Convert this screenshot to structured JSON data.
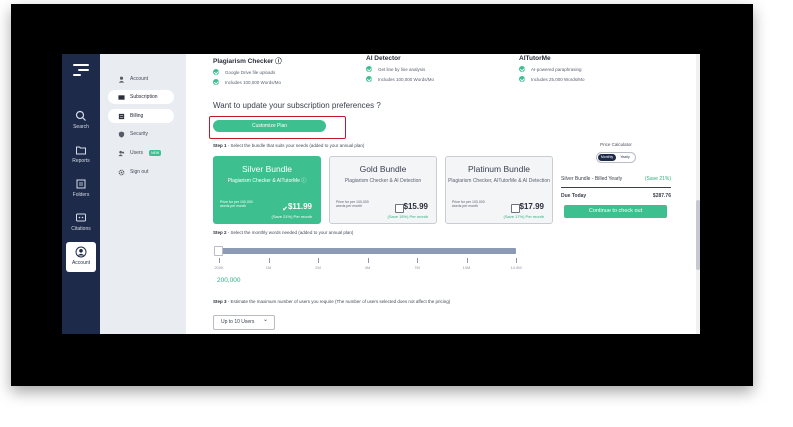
{
  "rail": {
    "items": [
      {
        "label": "Search"
      },
      {
        "label": "Reports"
      },
      {
        "label": "Folders"
      },
      {
        "label": "Citations"
      },
      {
        "label": "Account"
      }
    ]
  },
  "subnav": {
    "items": [
      {
        "label": "Account"
      },
      {
        "label": "Subscription"
      },
      {
        "label": "Billing"
      },
      {
        "label": "Security"
      },
      {
        "label": "Users",
        "badge": "NEW"
      },
      {
        "label": "Sign out"
      }
    ]
  },
  "features": [
    {
      "title": "Plagiarism Checker ⓘ",
      "lines": [
        "Google Drive file uploads",
        "Includes 100,000 Words/Mo"
      ]
    },
    {
      "title": "AI Detector",
      "lines": [
        "Get line by line analysis",
        "Includes 100,000 Words/Mo"
      ]
    },
    {
      "title": "AITutorMe",
      "lines": [
        "AI-powered paraphrasing",
        "Includes 25,000 Words/Mo"
      ]
    }
  ],
  "question": "Want to update your subscription preferences ?",
  "customize_button": "Customize Plan",
  "step1": {
    "label": "Step 1",
    "text": " - Select the bundle that suits your needs (added to your annual plan)"
  },
  "bundles": [
    {
      "title": "Silver Bundle",
      "desc": "Plagiarism Checker & AITutorMe ⓘ",
      "price_label": "Price for per 100,000 words per month",
      "price": "$11.99",
      "save": "(Save 21%)",
      "per": "Per month"
    },
    {
      "title": "Gold Bundle",
      "desc": "Plagiarism Checker & AI Detection",
      "price_label": "Price for per 100,000 words per month",
      "price": "$15.99",
      "save": "(Save 15%)",
      "per": "Per month"
    },
    {
      "title": "Platinum Bundle",
      "desc": "Plagiarism Checker, AITutorMe & AI Detection",
      "price_label": "Price for per 100,000 words per month",
      "price": "$17.99",
      "save": "(Save 17%)",
      "per": "Per month"
    }
  ],
  "calculator": {
    "title": "Price Calculator",
    "toggle": [
      "Monthly",
      "Yearly"
    ],
    "bundle_line": "Silver Bundle - Billed Yearly",
    "bundle_save": "(Save 21%)",
    "due_label": "Due Today",
    "due_value": "$287.76",
    "checkout": "Continue to check out"
  },
  "step2": {
    "label": "Step 2",
    "text": " - Select the monthly words needed (added to your annual plan)"
  },
  "slider": {
    "ticks": [
      "200K",
      "1M",
      "2M",
      "4M",
      "7M",
      "10M",
      "14.9M"
    ],
    "value_fraction": 0.0,
    "value": "200,000"
  },
  "step3": {
    "label": "Step 3",
    "text": " - Estimate the maximum number of users you require (The number of users selected does not affect the pricing)"
  },
  "users_select": "Up to 10 Users",
  "colors": {
    "accent": "#3dbf8f",
    "rail": "#1e2a4a",
    "highlight": "#c0182f"
  }
}
